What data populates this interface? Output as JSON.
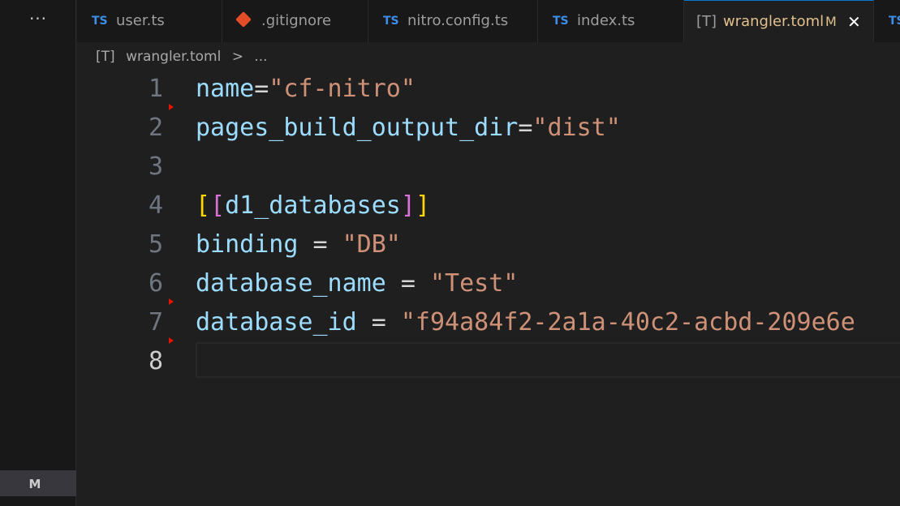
{
  "sidebar": {
    "more_label": "···",
    "badge": "M"
  },
  "tabs": [
    {
      "icon": "TS",
      "label": "user.ts"
    },
    {
      "icon": "git-icon",
      "label": ".gitignore"
    },
    {
      "icon": "TS",
      "label": "nitro.config.ts"
    },
    {
      "icon": "TS",
      "label": "index.ts"
    },
    {
      "icon": "[T]",
      "label": "wrangler.toml",
      "modified": "M",
      "close": "✕",
      "active": true
    },
    {
      "icon": "TS",
      "label": ""
    }
  ],
  "breadcrumb": {
    "icon": "[T]",
    "file": "wrangler.toml",
    "sep": ">",
    "rest": "..."
  },
  "editor": {
    "line_numbers": [
      "1",
      "2",
      "3",
      "4",
      "5",
      "6",
      "7",
      "8"
    ],
    "lines": [
      {
        "key": "name",
        "op": "=",
        "val": "\"cf-nitro\""
      },
      {
        "key": "pages_build_output_dir",
        "op": "=",
        "val": "\"dist\""
      },
      {},
      {
        "open1": "[",
        "open2": "[",
        "table": "d1_databases",
        "close2": "]",
        "close1": "]"
      },
      {
        "key": "binding",
        "op": " = ",
        "val": "\"DB\""
      },
      {
        "key": "database_name",
        "op": " = ",
        "val": "\"Test\""
      },
      {
        "key": "database_id",
        "op": " = ",
        "val": "\"f94a84f2-2a1a-40c2-acbd-209e6e"
      },
      {}
    ]
  },
  "colors": {
    "key": "#9cdcfe",
    "string": "#ce9178",
    "bracket1": "#ffd700",
    "bracket2": "#da70d6",
    "modified": "#e2c08d",
    "ts_icon": "#3b8eea"
  }
}
